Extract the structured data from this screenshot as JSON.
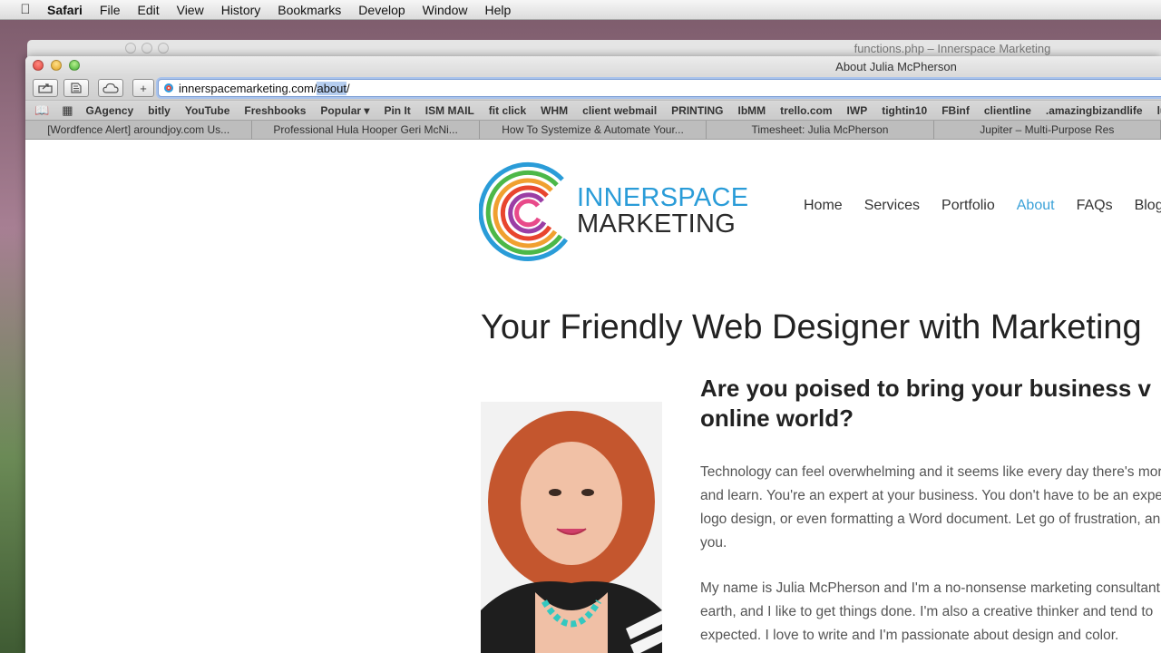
{
  "menubar": {
    "app": "Safari",
    "items": [
      "File",
      "Edit",
      "View",
      "History",
      "Bookmarks",
      "Develop",
      "Window",
      "Help"
    ]
  },
  "background_window": {
    "title": "functions.php – Innerspace Marketing"
  },
  "window": {
    "title": "About Julia McPherson"
  },
  "toolbar": {
    "add_tab_label": "+",
    "url_before": "innerspacemarketing.com/",
    "url_selected": "about",
    "url_after": "/"
  },
  "bookmarks": [
    "GAgency",
    "bitly",
    "YouTube",
    "Freshbooks",
    "Popular ▾",
    "Pin It",
    "ISM MAIL",
    "fit click",
    "WHM",
    "client webmail",
    "PRINTING",
    "IbMM",
    "trello.com",
    "IWP",
    "tightin10",
    "FBinf",
    "clientline",
    ".amazingbizandlife",
    "luc"
  ],
  "tabs": [
    "[Wordfence Alert] aroundjoy.com Us...",
    "Professional Hula Hooper Geri McNi...",
    "How To Systemize & Automate Your...",
    "Timesheet: Julia McPherson",
    "Jupiter – Multi-Purpose Res"
  ],
  "site": {
    "brand_line1": "INNERSPACE",
    "brand_line2": "MARKETING",
    "nav": [
      "Home",
      "Services",
      "Portfolio",
      "About",
      "FAQs",
      "Blog"
    ],
    "heading": "Your Friendly Web Designer with Marketing",
    "subheading": "Are you poised to bring your business v online world?",
    "para1": "Technology can feel overwhelming and it seems like every day there's more and learn. You're an expert at your business. You don't have to be an expe logo design, or even formatting a Word document. Let go of frustration, an you.",
    "para2": "My name is Julia McPherson and I'm a no-nonsense marketing consultant earth, and I like to get things done. I'm also a creative thinker and tend to expected. I love to write and I'm passionate about design and color."
  },
  "colors": {
    "brand_blue": "#2a9cd8",
    "nav_active": "#3aa1d8"
  }
}
